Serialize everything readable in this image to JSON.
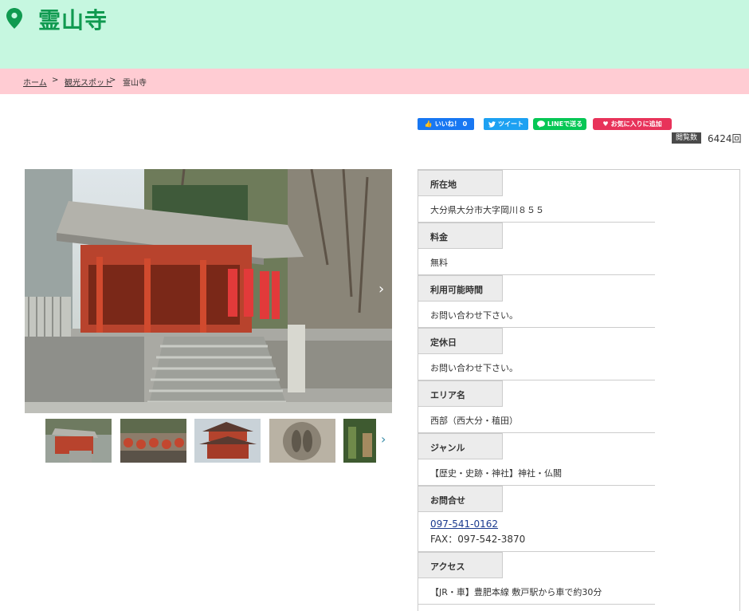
{
  "header": {
    "title": "霊山寺",
    "accent": "#109a50",
    "background": "#c6f7e0",
    "icon": "map-pin-icon"
  },
  "breadcrumb": {
    "home": "ホーム",
    "sep1": ">",
    "spots": "観光スポット",
    "sep2": ">",
    "current": "霊山寺"
  },
  "share": {
    "facebook": "いいね！ 0",
    "twitter": "ツイート",
    "line": "LINEで送る",
    "favorite": "お気に入りに追加"
  },
  "views": {
    "label": "閲覧数",
    "count": "6424回"
  },
  "details": [
    {
      "label": "所在地",
      "value": "大分県大分市大字岡川８５５"
    },
    {
      "label": "料金",
      "value": "無料"
    },
    {
      "label": "利用可能時間",
      "value": "お問い合わせ下さい。"
    },
    {
      "label": "定休日",
      "value": "お問い合わせ下さい。"
    },
    {
      "label": "エリア名",
      "value": "西部（西大分・稙田）"
    },
    {
      "label": "ジャンル",
      "value": "【歴史・史跡・神社】神社・仏閣"
    },
    {
      "label": "お問合せ",
      "phone": "097-541-0162",
      "fax": "FAX：097-542-3870"
    },
    {
      "label": "アクセス",
      "value": "【JR・車】豊肥本線 敷戸駅から車で約30分"
    }
  ]
}
